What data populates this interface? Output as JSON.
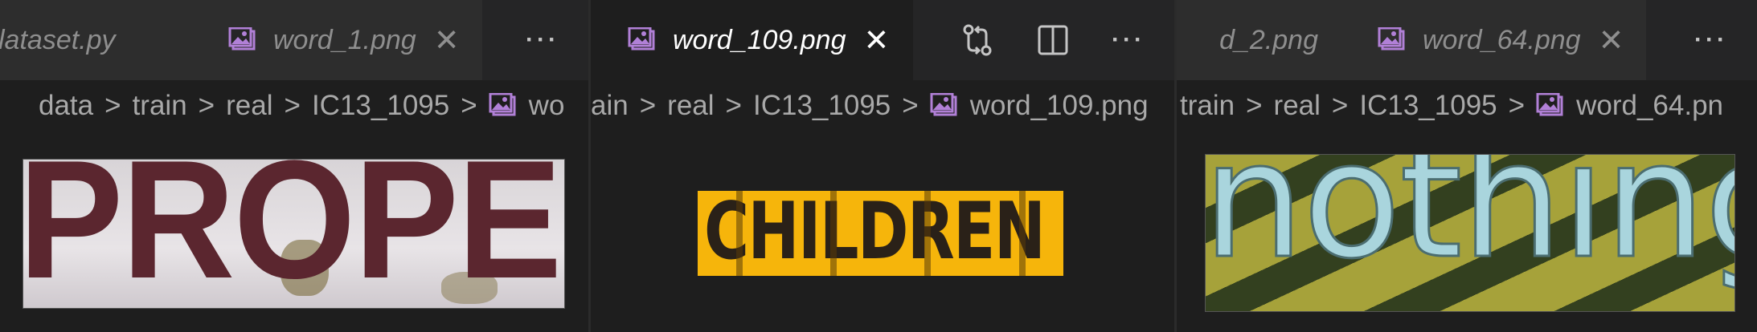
{
  "colors": {
    "icon_purple": "#b180d7",
    "background": "#1e1e1e",
    "tabbar": "#252526"
  },
  "group1": {
    "tabs": [
      {
        "label": "lataset.py",
        "active": false
      },
      {
        "label": "word_1.png",
        "active": false
      }
    ],
    "more_label": "···",
    "breadcrumbs": [
      "data",
      "train",
      "real",
      "IC13_1095",
      "wo"
    ],
    "image_text": "PROPER"
  },
  "group2": {
    "tabs": [
      {
        "label": "word_109.png",
        "active": true
      }
    ],
    "more_label": "···",
    "breadcrumbs": [
      "ain",
      "real",
      "IC13_1095",
      "word_109.png"
    ],
    "image_text": "CHILDREN"
  },
  "group3": {
    "tabs": [
      {
        "label": "d_2.png",
        "active": false
      },
      {
        "label": "word_64.png",
        "active": false
      }
    ],
    "more_label": "···",
    "breadcrumbs": [
      "train",
      "real",
      "IC13_1095",
      "word_64.pn"
    ],
    "image_text": "nothing"
  },
  "separator": ">",
  "close_glyph": "✕"
}
